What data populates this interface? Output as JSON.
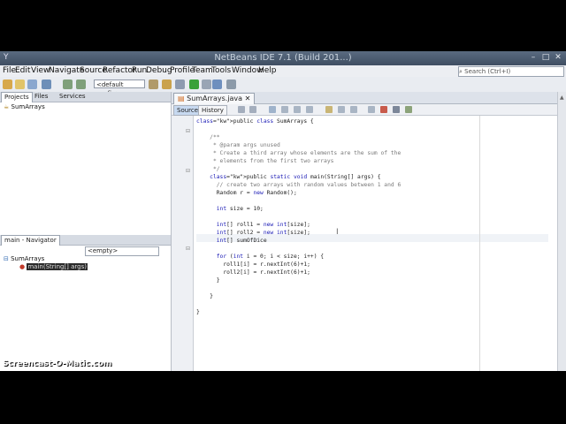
{
  "window": {
    "title": "NetBeans IDE 7.1 (Build 201...)"
  },
  "menu": [
    "File",
    "Edit",
    "View",
    "Navigate",
    "Source",
    "Refactor",
    "Run",
    "Debug",
    "Profile",
    "Team",
    "Tools",
    "Window",
    "Help"
  ],
  "search": {
    "placeholder": "Search (Ctrl+I)"
  },
  "toolbar": {
    "config": "<default config>"
  },
  "projects": {
    "tabs": [
      "Projects",
      "Files",
      "Services"
    ],
    "tree_root": "SumArrays"
  },
  "navigator": {
    "title": "main - Navigator",
    "filter": "<empty>",
    "tree_root": "SumArrays",
    "tree_item": "main(String[] args)"
  },
  "editor": {
    "file_tab": "SumArrays.java",
    "source_btn": "Source",
    "history_btn": "History",
    "lines": [
      "public class SumArrays {",
      "",
      "    /**",
      "     * @param args unused",
      "     * Create a third array whose elements are the sum of the",
      "     * elements from the first two arrays",
      "     */",
      "    public static void main(String[] args) {",
      "      // create two arrays with random values between 1 and 6",
      "      Random r = new Random();",
      "",
      "      int size = 10;",
      "",
      "      int[] roll1 = new int[size];",
      "      int[] roll2 = new int[size];",
      "      int[] sumOfDice",
      "",
      "      for (int i = 0; i < size; i++) {",
      "        roll1[i] = r.nextInt(6)+1;",
      "        roll2[i] = r.nextInt(6)+1;",
      "      }",
      "",
      "    }",
      "",
      "}"
    ]
  },
  "watermark": "Screencast-O-Matic.com"
}
